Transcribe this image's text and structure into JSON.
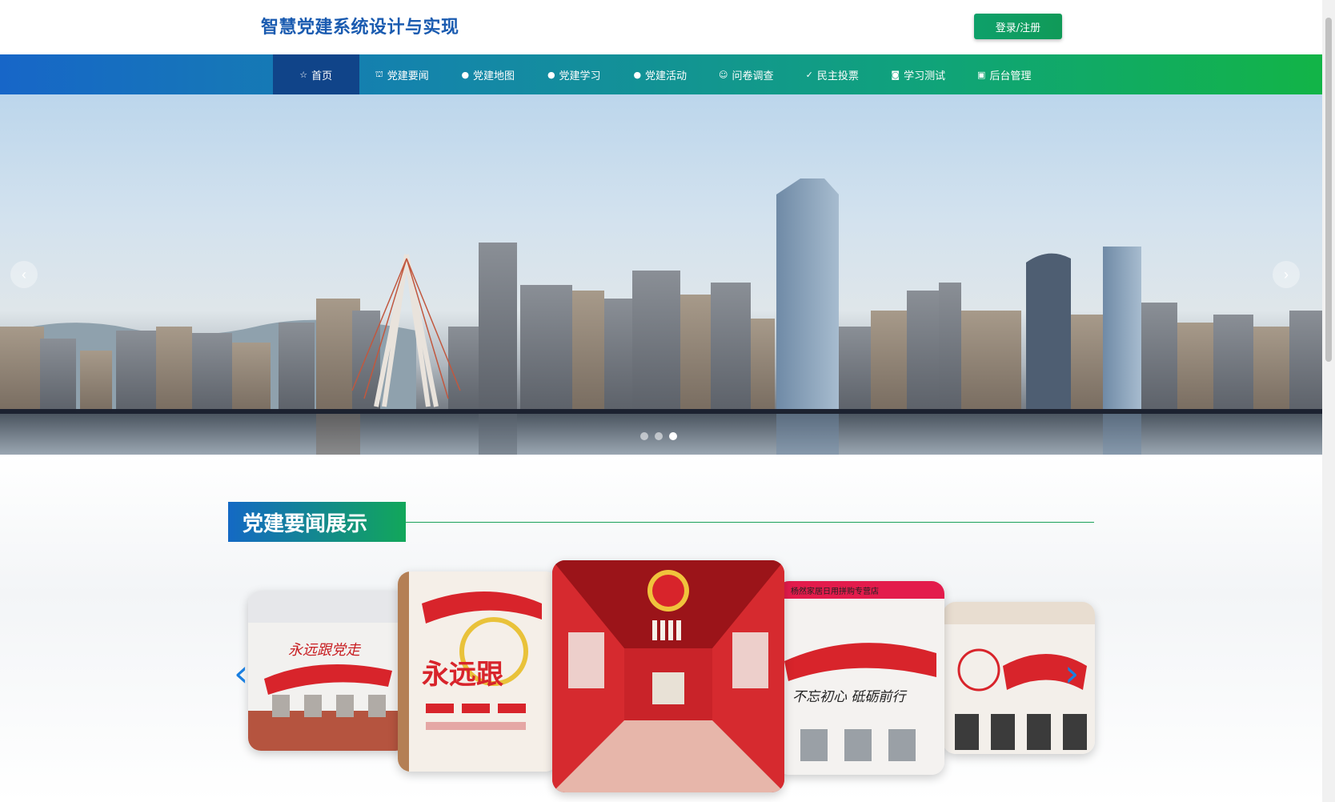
{
  "header": {
    "title": "智慧党建系统设计与实现",
    "login_label": "登录/注册"
  },
  "nav": {
    "items": [
      {
        "label": "首页",
        "icon": "star-icon",
        "active": true
      },
      {
        "label": "党建要闻",
        "icon": "bag-icon"
      },
      {
        "label": "党建地图",
        "icon": "info-circle-icon"
      },
      {
        "label": "党建学习",
        "icon": "question-circle-icon"
      },
      {
        "label": "党建活动",
        "icon": "info-circle-icon"
      },
      {
        "label": "问卷调查",
        "icon": "smile-circle-icon"
      },
      {
        "label": "民主投票",
        "icon": "check-circle-icon"
      },
      {
        "label": "学习测试",
        "icon": "camera-icon"
      },
      {
        "label": "后台管理",
        "icon": "briefcase-icon"
      }
    ]
  },
  "banner": {
    "prev_icon": "chevron-left-icon",
    "next_icon": "chevron-right-icon",
    "slide_count": 3,
    "active_slide": 3
  },
  "news_section": {
    "title": "党建要闻展示",
    "prev_icon": "chevron-left-icon",
    "next_icon": "chevron-right-icon",
    "cards": [
      {
        "caption": "永远跟党走"
      },
      {
        "caption": "永远跟"
      },
      {
        "caption": ""
      },
      {
        "caption": "不忘初心 砥砺前行",
        "top_text": "杨然家居日用拼购专营店"
      },
      {
        "caption": ""
      }
    ]
  },
  "colors": {
    "brand_blue": "#1766c8",
    "brand_green": "#12b447",
    "active_nav": "#104489",
    "party_red": "#d8242b"
  }
}
